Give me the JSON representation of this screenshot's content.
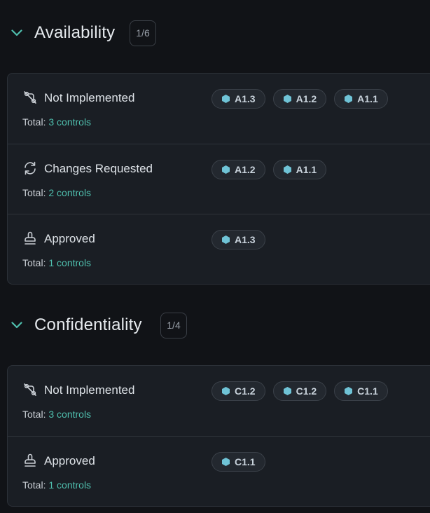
{
  "colors": {
    "background": "#111317",
    "card": "#1a1e24",
    "accent": "#4fbfae",
    "chip_icon": "#6fc3d6"
  },
  "sections": [
    {
      "title": "Availability",
      "count": "1/6",
      "rows": [
        {
          "status": "Not Implemented",
          "icon": "not-implemented-icon",
          "total_prefix": "Total:",
          "total_value": "3 controls",
          "chips": [
            "A1.3",
            "A1.2",
            "A1.1"
          ]
        },
        {
          "status": "Changes Requested",
          "icon": "refresh-icon",
          "total_prefix": "Total:",
          "total_value": "2 controls",
          "chips": [
            "A1.2",
            "A1.1"
          ]
        },
        {
          "status": "Approved",
          "icon": "stamp-icon",
          "total_prefix": "Total:",
          "total_value": "1 controls",
          "chips": [
            "A1.3"
          ]
        }
      ]
    },
    {
      "title": "Confidentiality",
      "count": "1/4",
      "rows": [
        {
          "status": "Not Implemented",
          "icon": "not-implemented-icon",
          "total_prefix": "Total:",
          "total_value": "3 controls",
          "chips": [
            "C1.2",
            "C1.2",
            "C1.1"
          ]
        },
        {
          "status": "Approved",
          "icon": "stamp-icon",
          "total_prefix": "Total:",
          "total_value": "1 controls",
          "chips": [
            "C1.1"
          ]
        }
      ]
    }
  ]
}
